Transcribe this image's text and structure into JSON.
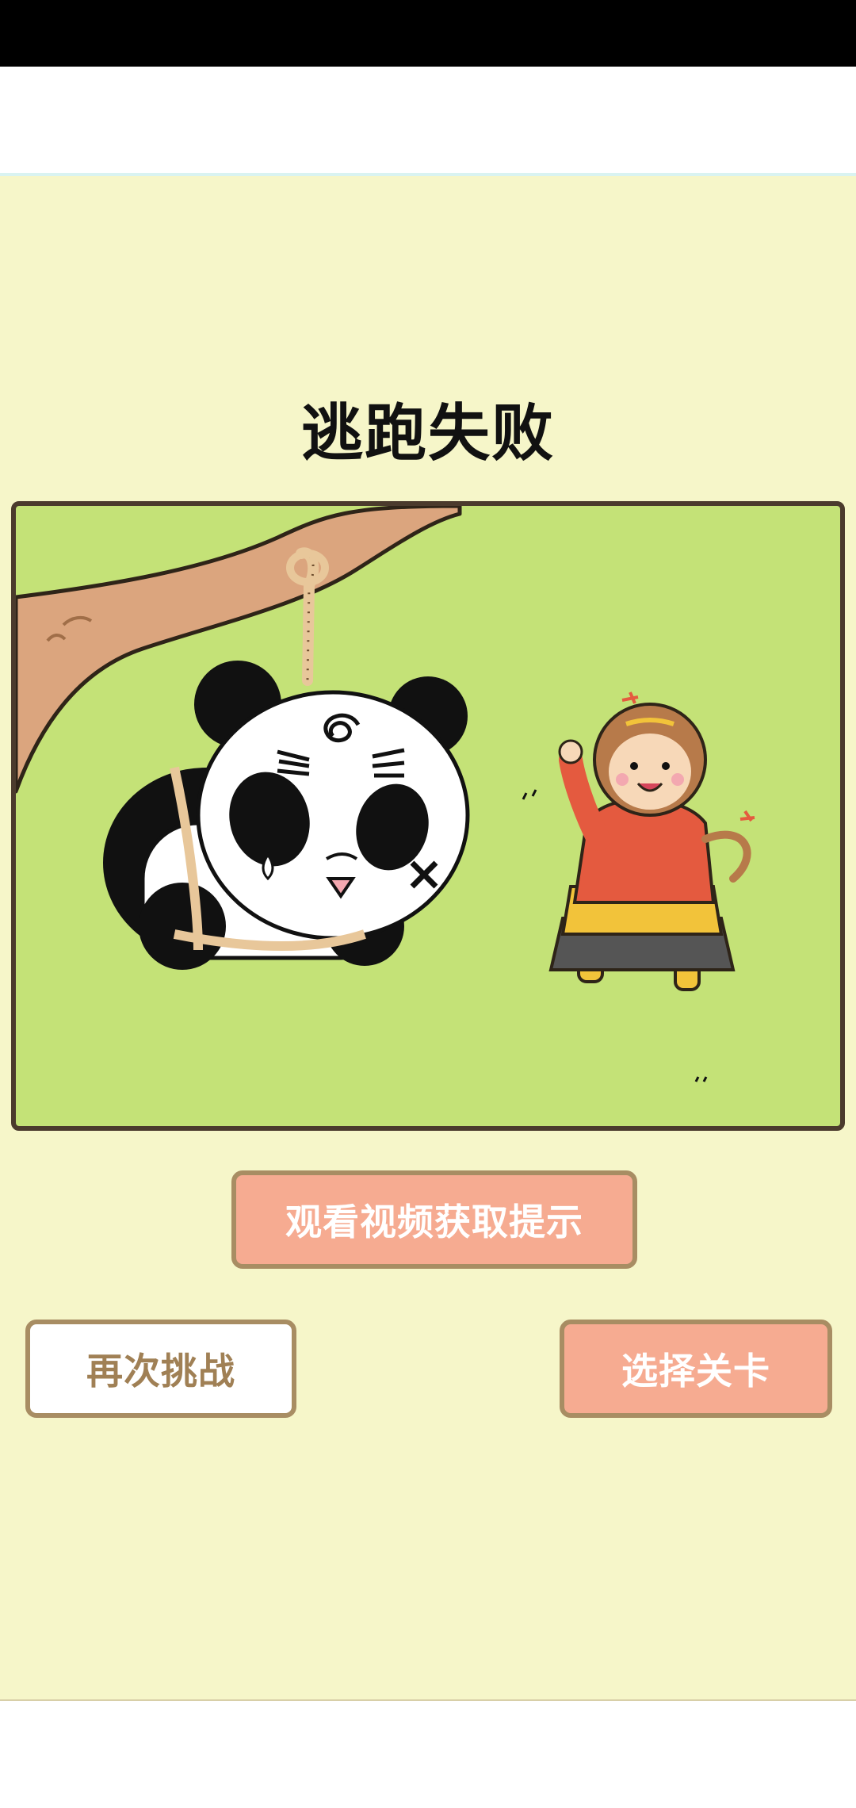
{
  "screen": {
    "title": "逃跑失败"
  },
  "scene": {
    "image": "panda-hanging-from-branch-and-laughing-monkey-king",
    "colors": {
      "background": "#c4e277",
      "frame": "#4b3b2d",
      "branch": "#dba57e",
      "rope": "#e8c79a",
      "monkey_robe": "#e45a3f",
      "monkey_armor": "#f2c33a"
    }
  },
  "buttons": {
    "hint": "观看视频获取提示",
    "retry": "再次挑战",
    "select_level": "选择关卡"
  },
  "colors": {
    "page_background": "#f6f6c9",
    "primary_button": "#f6ab91",
    "button_border": "#a88d63",
    "secondary_text": "#a08055"
  }
}
